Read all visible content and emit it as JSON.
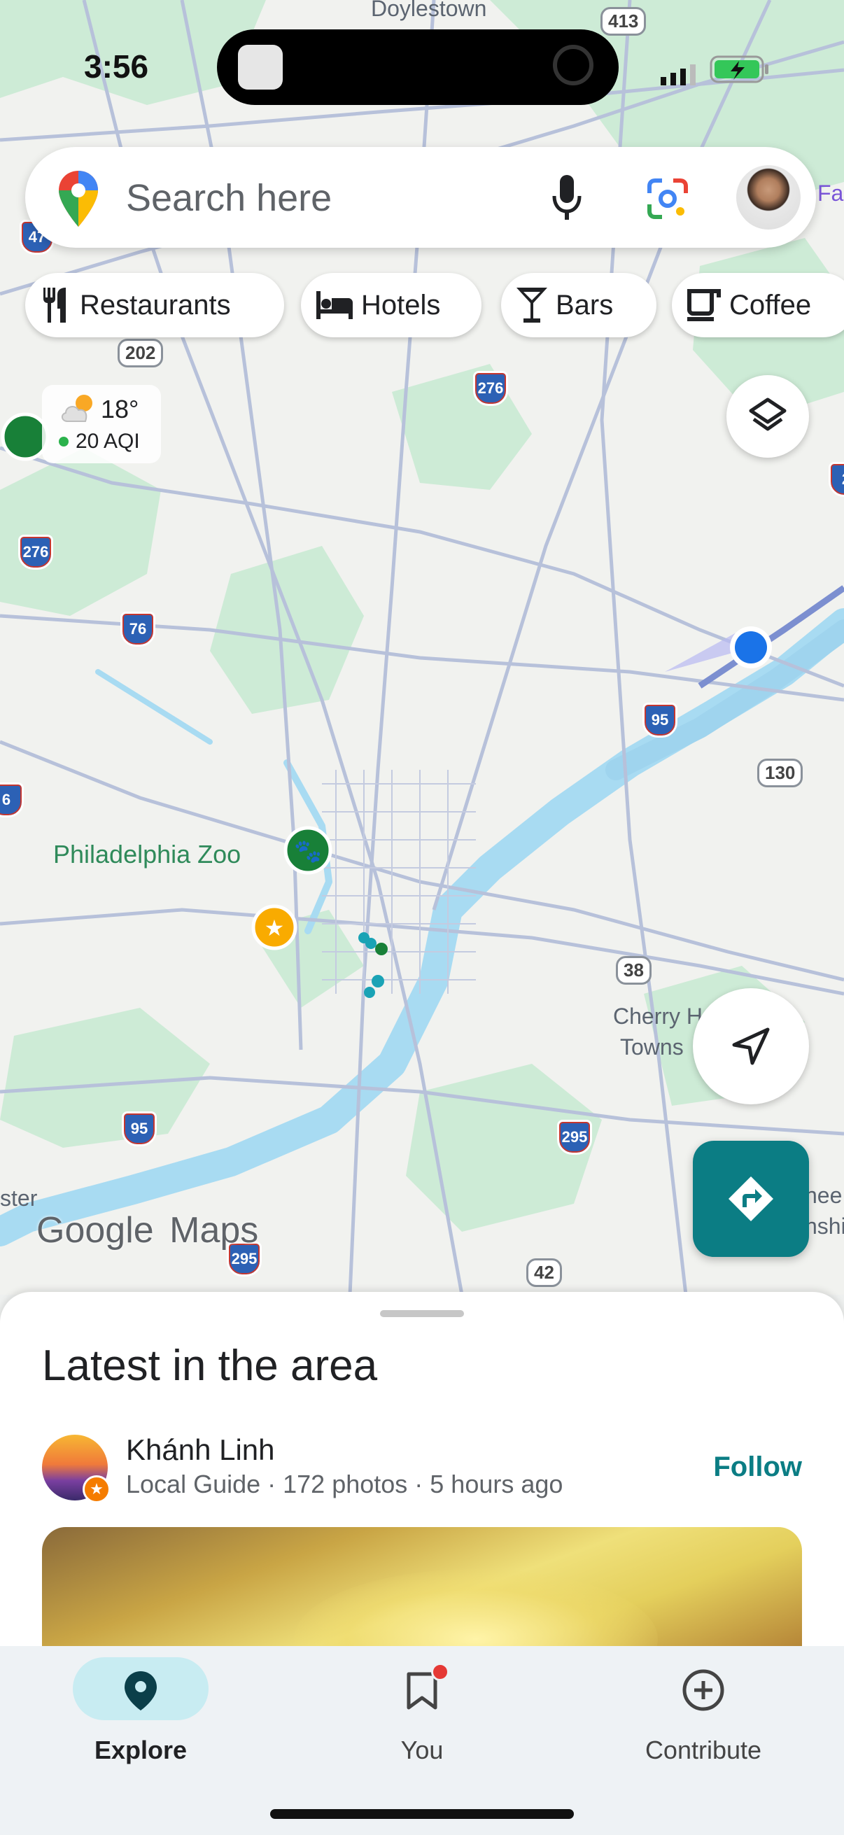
{
  "status_bar": {
    "time": "3:56"
  },
  "search": {
    "placeholder": "Search here"
  },
  "chips": [
    {
      "label": "Restaurants",
      "icon": "fork-knife-icon"
    },
    {
      "label": "Hotels",
      "icon": "bed-icon"
    },
    {
      "label": "Bars",
      "icon": "cocktail-icon"
    },
    {
      "label": "Coffee",
      "icon": "coffee-cup-icon"
    }
  ],
  "weather": {
    "temp": "18°",
    "aqi": "20 AQI"
  },
  "map": {
    "place_labels": {
      "doylestown": "Doylestown",
      "zoo": "Philadelphia Zoo",
      "cherry": "Cherry H",
      "towns": "Towns",
      "ster": "ster",
      "hee": "hee",
      "nshi": "nshi",
      "fa": "Fa"
    },
    "route_shields": {
      "r413": "413",
      "r202": "202",
      "r276a": "276",
      "r276b": "276",
      "r76a": "76",
      "r76b": "6",
      "r95a": "95",
      "r95b": "95",
      "r130": "130",
      "r38": "38",
      "r295a": "295",
      "r295b": "295",
      "r42": "42",
      "r47": "47",
      "r2": "2"
    },
    "logo_text": {
      "google": "Google",
      "maps": "Maps"
    },
    "colors": {
      "water": "#a8dbf2",
      "park": "#cdebd6",
      "road": "#b7c1da",
      "location": "#1a73e8"
    }
  },
  "sheet": {
    "title": "Latest in the area",
    "author": "Khánh Linh",
    "meta": "Local Guide · 172 photos · 5 hours ago",
    "follow": "Follow"
  },
  "nav": [
    {
      "label": "Explore",
      "icon": "location-pin-icon",
      "active": true
    },
    {
      "label": "You",
      "icon": "bookmark-icon",
      "badge": true
    },
    {
      "label": "Contribute",
      "icon": "add-circle-icon"
    }
  ],
  "accent": "#0b7d84"
}
